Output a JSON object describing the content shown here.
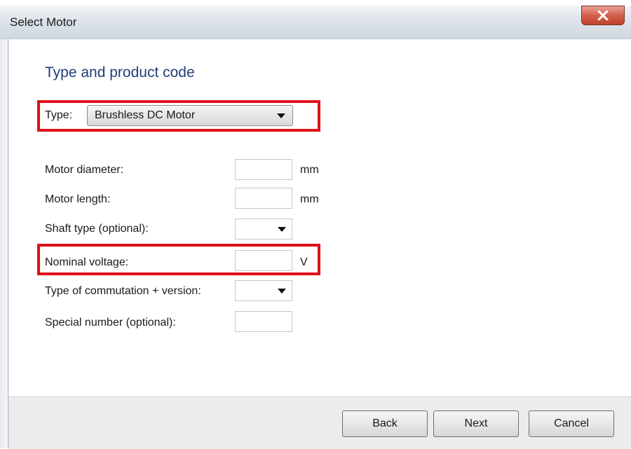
{
  "window": {
    "title": "Select Motor",
    "close_icon": "close-x-icon",
    "close_color": "#c94a37"
  },
  "form": {
    "heading": "Type and product code",
    "type": {
      "label": "Type:",
      "value": "Brushless DC Motor"
    },
    "fields": [
      {
        "label": "Motor diameter:",
        "value": "",
        "unit": "mm",
        "control": "text"
      },
      {
        "label": "Motor length:",
        "value": "",
        "unit": "mm",
        "control": "text"
      },
      {
        "label": "Shaft type (optional):",
        "value": "",
        "unit": "",
        "control": "dropdown"
      },
      {
        "label": "Nominal voltage:",
        "value": "",
        "unit": "V",
        "control": "text"
      },
      {
        "label": "Type of commutation + version:",
        "value": "",
        "unit": "",
        "control": "dropdown"
      },
      {
        "label": "Special number (optional):",
        "value": "",
        "unit": "",
        "control": "text"
      }
    ]
  },
  "highlight_color": "#e0101a",
  "buttons": {
    "back": "Back",
    "next": "Next",
    "cancel": "Cancel"
  }
}
